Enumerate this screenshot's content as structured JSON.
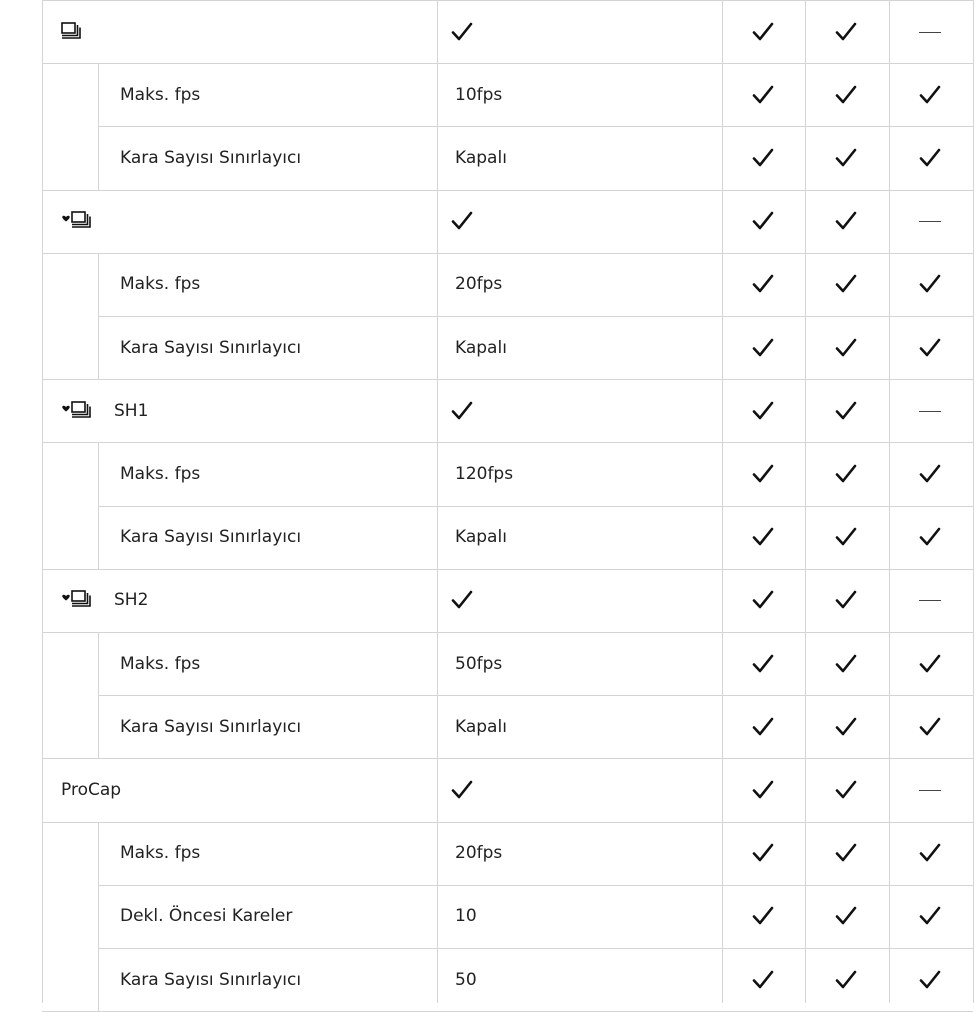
{
  "groups": [
    {
      "icon": "sequential-shooting-icon",
      "header": {
        "label": "",
        "value_check": true,
        "flags": [
          "check",
          "check",
          "dash"
        ]
      },
      "rows": [
        {
          "label": "Maks. fps",
          "value": "10fps",
          "flags": [
            "check",
            "check",
            "check"
          ]
        },
        {
          "label": "Kara Sayısı Sınırlayıcı",
          "value": "Kapalı",
          "flags": [
            "check",
            "check",
            "check"
          ]
        }
      ]
    },
    {
      "icon": "silent-sequential-shooting-icon",
      "header": {
        "label": "",
        "value_check": true,
        "flags": [
          "check",
          "check",
          "dash"
        ]
      },
      "rows": [
        {
          "label": "Maks. fps",
          "value": "20fps",
          "flags": [
            "check",
            "check",
            "check"
          ]
        },
        {
          "label": "Kara Sayısı Sınırlayıcı",
          "value": "Kapalı",
          "flags": [
            "check",
            "check",
            "check"
          ]
        }
      ]
    },
    {
      "icon": "silent-sequential-sh-icon",
      "header": {
        "label": "SH1",
        "value_check": true,
        "flags": [
          "check",
          "check",
          "dash"
        ]
      },
      "rows": [
        {
          "label": "Maks. fps",
          "value": "120fps",
          "flags": [
            "check",
            "check",
            "check"
          ]
        },
        {
          "label": "Kara Sayısı Sınırlayıcı",
          "value": "Kapalı",
          "flags": [
            "check",
            "check",
            "check"
          ]
        }
      ]
    },
    {
      "icon": "silent-sequential-sh-icon",
      "header": {
        "label": "SH2",
        "value_check": true,
        "flags": [
          "check",
          "check",
          "dash"
        ]
      },
      "rows": [
        {
          "label": "Maks. fps",
          "value": "50fps",
          "flags": [
            "check",
            "check",
            "check"
          ]
        },
        {
          "label": "Kara Sayısı Sınırlayıcı",
          "value": "Kapalı",
          "flags": [
            "check",
            "check",
            "check"
          ]
        }
      ]
    },
    {
      "icon": "",
      "header": {
        "label": "ProCap",
        "value_check": true,
        "flags": [
          "check",
          "check",
          "dash"
        ]
      },
      "rows": [
        {
          "label": "Maks. fps",
          "value": "20fps",
          "flags": [
            "check",
            "check",
            "check"
          ]
        },
        {
          "label": "Dekl. Öncesi Kareler",
          "value": "10",
          "flags": [
            "check",
            "check",
            "check"
          ]
        },
        {
          "label": "Kara Sayısı Sınırlayıcı",
          "value": "50",
          "flags": [
            "check",
            "check",
            "check"
          ]
        }
      ]
    }
  ]
}
